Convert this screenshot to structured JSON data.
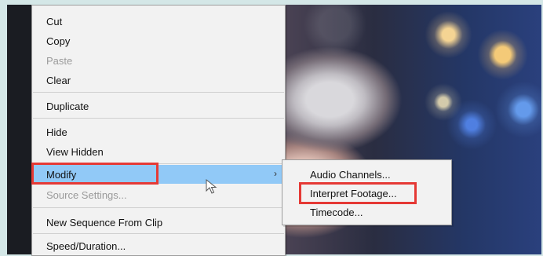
{
  "context_menu": {
    "items": [
      {
        "label": "Cut"
      },
      {
        "label": "Copy"
      },
      {
        "label": "Paste"
      },
      {
        "label": "Clear"
      },
      {
        "label": "Duplicate"
      },
      {
        "label": "Hide"
      },
      {
        "label": "View Hidden"
      },
      {
        "label": "Modify"
      },
      {
        "label": "Source Settings..."
      },
      {
        "label": "New Sequence From Clip"
      },
      {
        "label": "Speed/Duration..."
      }
    ]
  },
  "submenu": {
    "items": [
      {
        "label": "Audio Channels..."
      },
      {
        "label": "Interpret Footage..."
      },
      {
        "label": "Timecode..."
      }
    ]
  },
  "icons": {
    "arrow": "chevron-right-icon",
    "cursor": "mouse-cursor-icon"
  },
  "colors": {
    "highlight": "#91c9f7",
    "callout": "#e53935"
  }
}
